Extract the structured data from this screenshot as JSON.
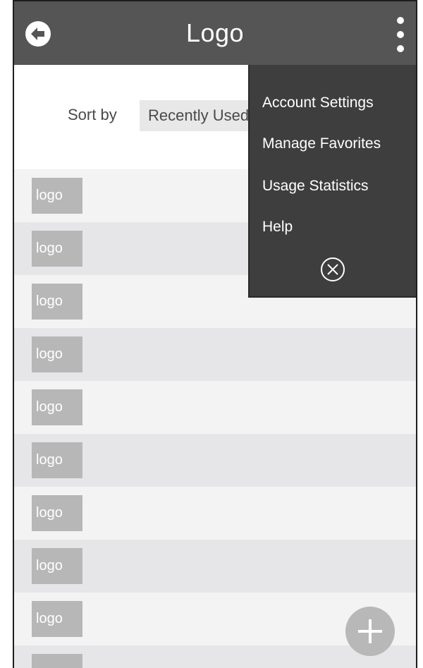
{
  "header": {
    "title": "Logo",
    "back_icon": "arrow-left-circle-icon",
    "more_icon": "kebab-menu-icon"
  },
  "sort": {
    "label": "Sort by",
    "selected": "Recently Used"
  },
  "list": {
    "items": [
      {
        "logo_text": "logo"
      },
      {
        "logo_text": "logo"
      },
      {
        "logo_text": "logo"
      },
      {
        "logo_text": "logo"
      },
      {
        "logo_text": "logo"
      },
      {
        "logo_text": "logo"
      },
      {
        "logo_text": "logo"
      },
      {
        "logo_text": "logo"
      },
      {
        "logo_text": "logo"
      },
      {
        "logo_text": ""
      }
    ]
  },
  "menu": {
    "items": [
      {
        "label": "Account Settings"
      },
      {
        "label": "Manage Favorites"
      },
      {
        "label": "Usage Statistics"
      },
      {
        "label": "Help"
      }
    ],
    "close_icon": "close-circle-icon"
  },
  "fab": {
    "icon": "plus-icon"
  },
  "colors": {
    "appbar": "#555555",
    "menu": "#3e3e3e",
    "row_light": "#f3f3f4",
    "row_dark": "#e6e6e8",
    "logo_box": "#b7b7b7"
  }
}
